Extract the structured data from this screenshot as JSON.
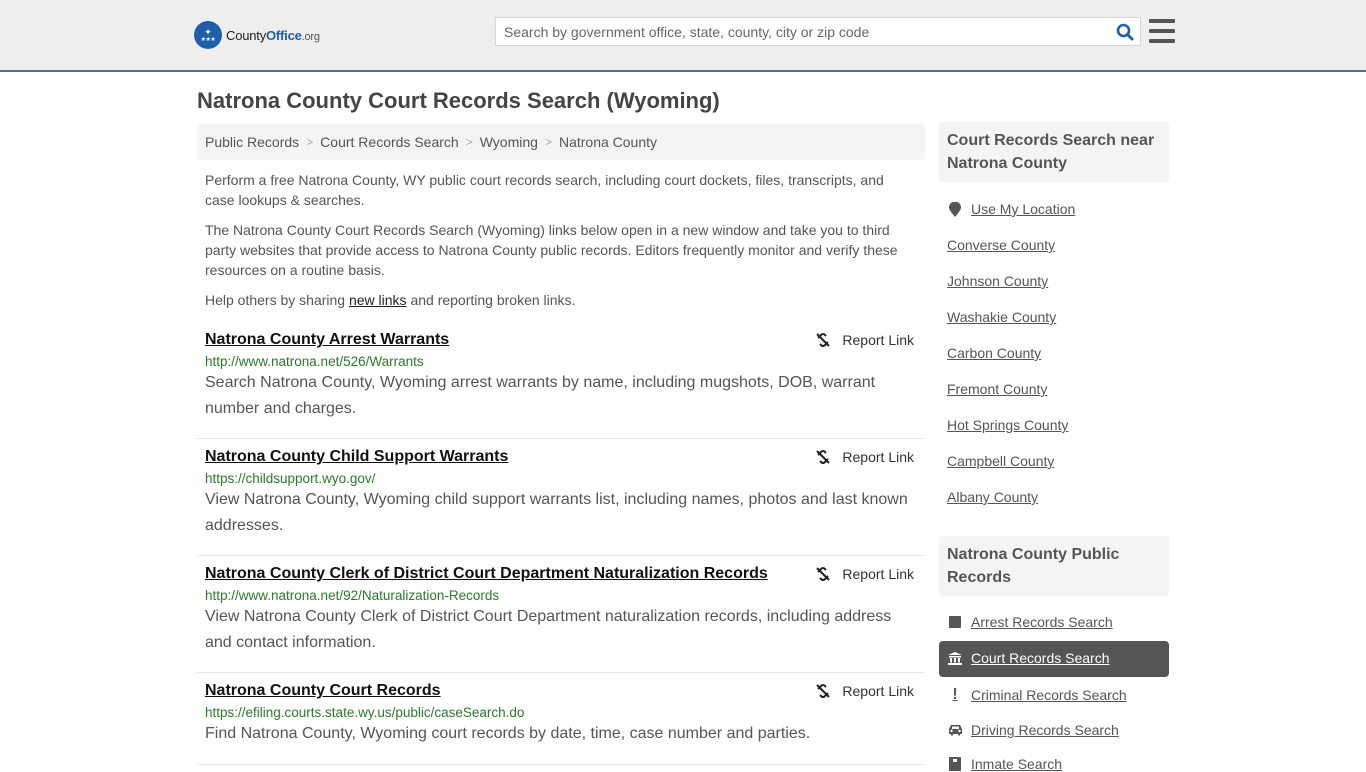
{
  "header": {
    "logo": {
      "county": "County",
      "office": "Office",
      "org": ".org"
    },
    "search": {
      "placeholder": "Search by government office, state, county, city or zip code",
      "value": ""
    },
    "icons": {
      "search": "search-icon",
      "menu": "hamburger-menu-icon",
      "logo": "eagle-stars-badge-icon"
    }
  },
  "page": {
    "title": "Natrona County Court Records Search (Wyoming)",
    "breadcrumb": [
      "Public Records",
      "Court Records Search",
      "Wyoming",
      "Natrona County"
    ],
    "intro": {
      "p1": "Perform a free Natrona County, WY public court records search, including court dockets, files, transcripts, and case lookups & searches.",
      "p2": "The Natrona County Court Records Search (Wyoming) links below open in a new window and take you to third party websites that provide access to Natrona County public records. Editors frequently monitor and verify these resources on a routine basis.",
      "p3_before": "Help others by sharing ",
      "p3_link": "new links",
      "p3_after": " and reporting broken links."
    },
    "report_label": "Report Link",
    "results": [
      {
        "title": "Natrona County Arrest Warrants",
        "url": "http://www.natrona.net/526/Warrants",
        "description": "Search Natrona County, Wyoming arrest warrants by name, including mugshots, DOB, warrant number and charges."
      },
      {
        "title": "Natrona County Child Support Warrants",
        "url": "https://childsupport.wyo.gov/",
        "description": "View Natrona County, Wyoming child support warrants list, including names, photos and last known addresses."
      },
      {
        "title": "Natrona County Clerk of District Court Department Naturalization Records",
        "url": "http://www.natrona.net/92/Naturalization-Records",
        "description": "View Natrona County Clerk of District Court Department naturalization records, including address and contact information."
      },
      {
        "title": "Natrona County Court Records",
        "url": "https://efiling.courts.state.wy.us/public/caseSearch.do",
        "description": "Find Natrona County, Wyoming court records by date, time, case number and parties."
      }
    ]
  },
  "sidebar": {
    "nearby": {
      "title": "Court Records Search near Natrona County",
      "use_location": "Use My Location",
      "counties": [
        "Converse County",
        "Johnson County",
        "Washakie County",
        "Carbon County",
        "Fremont County",
        "Hot Springs County",
        "Campbell County",
        "Albany County"
      ]
    },
    "public_records": {
      "title": "Natrona County Public Records",
      "items": [
        {
          "label": "Arrest Records Search",
          "icon": "square-icon",
          "active": false
        },
        {
          "label": "Court Records Search",
          "icon": "courthouse-icon",
          "active": true
        },
        {
          "label": "Criminal Records Search",
          "icon": "exclamation-icon",
          "active": false
        },
        {
          "label": "Driving Records Search",
          "icon": "car-icon",
          "active": false
        },
        {
          "label": "Inmate Search",
          "icon": "inmate-icon",
          "active": false
        }
      ]
    }
  },
  "colors": {
    "header_bg": "#eeeeee",
    "header_border": "#3d7aab",
    "brand_blue": "#1f5fa8",
    "url_green": "#2c7a2c",
    "active_bg": "#555555"
  }
}
